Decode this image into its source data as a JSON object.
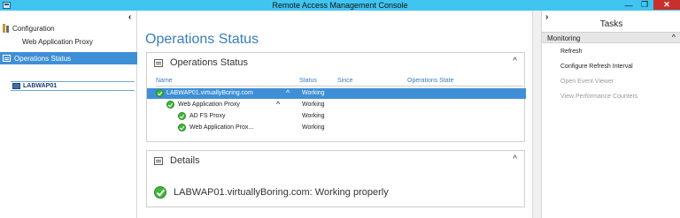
{
  "window": {
    "title": "Remote Access Management Console",
    "min_glyph": "—",
    "max_glyph": "❐",
    "close_glyph": "✕"
  },
  "left_nav": {
    "collapse_glyph": "‹",
    "configuration": "Configuration",
    "web_application_proxy": "Web Application Proxy",
    "operations_status": "Operations Status",
    "server": "LABWAP01"
  },
  "main": {
    "page_title": "Operations Status",
    "ops_panel": {
      "title": "Operations Status",
      "toggle_glyph": "^",
      "columns": {
        "name": "Name",
        "status": "Status",
        "since": "Since",
        "state": "Operations State"
      },
      "rows": [
        {
          "name": "LABWAP01.virtuallyBoring.com",
          "status": "Working",
          "chevron": "^"
        },
        {
          "name": "Web Application Proxy",
          "status": "Working",
          "chevron": "^"
        },
        {
          "name": "AD FS Proxy",
          "status": "Working",
          "chevron": ""
        },
        {
          "name": "Web Application Prox...",
          "status": "Working",
          "chevron": ""
        }
      ]
    },
    "details_panel": {
      "title": "Details",
      "toggle_glyph": "^",
      "message": "LABWAP01.virtuallyBoring.com: Working properly"
    }
  },
  "tasks": {
    "collapse_glyph": "›",
    "title": "Tasks",
    "section": "Monitoring",
    "section_chevron": "^",
    "items": [
      {
        "label": "Refresh",
        "enabled": true
      },
      {
        "label": "Configure Refresh Interval",
        "enabled": true
      },
      {
        "label": "Open Event Viewer",
        "enabled": false
      },
      {
        "label": "View Performance Counters",
        "enabled": false
      }
    ]
  },
  "colors": {
    "titlebar": "#40c4f0",
    "selection": "#3f8fd6",
    "accent_text": "#3a7dbf",
    "ok_green": "#3fb63a",
    "close_red": "#c7302c"
  }
}
